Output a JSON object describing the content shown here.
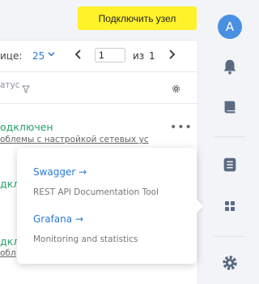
{
  "header": {
    "connect_button": "Подключить узел"
  },
  "pager": {
    "per_page_label": "ице:",
    "per_page_value": "25",
    "page_value": "1",
    "of_label": "из",
    "total_pages": "1"
  },
  "table": {
    "status_col": "атус"
  },
  "rows": [
    {
      "status": "одключен",
      "description": "облемы с настройкой сетевых ус"
    }
  ],
  "ghost_rows": [
    {
      "status": "дкл"
    },
    {
      "status": "дкл",
      "desc": "обл"
    }
  ],
  "popup": {
    "items": [
      {
        "title": "Swagger →",
        "desc": "REST API Documentation Tool"
      },
      {
        "title": "Grafana →",
        "desc": "Monitoring and statistics"
      }
    ]
  },
  "sidebar": {
    "avatar_letter": "A",
    "icons": [
      "bell-icon",
      "book-icon",
      "list-icon",
      "apps-grid-icon",
      "gear-icon"
    ]
  },
  "colors": {
    "accent": "#2b7ad4",
    "success": "#22a06b",
    "button": "#fff12a",
    "avatar": "#4a90e2",
    "rail_icon": "#5a6b80"
  }
}
